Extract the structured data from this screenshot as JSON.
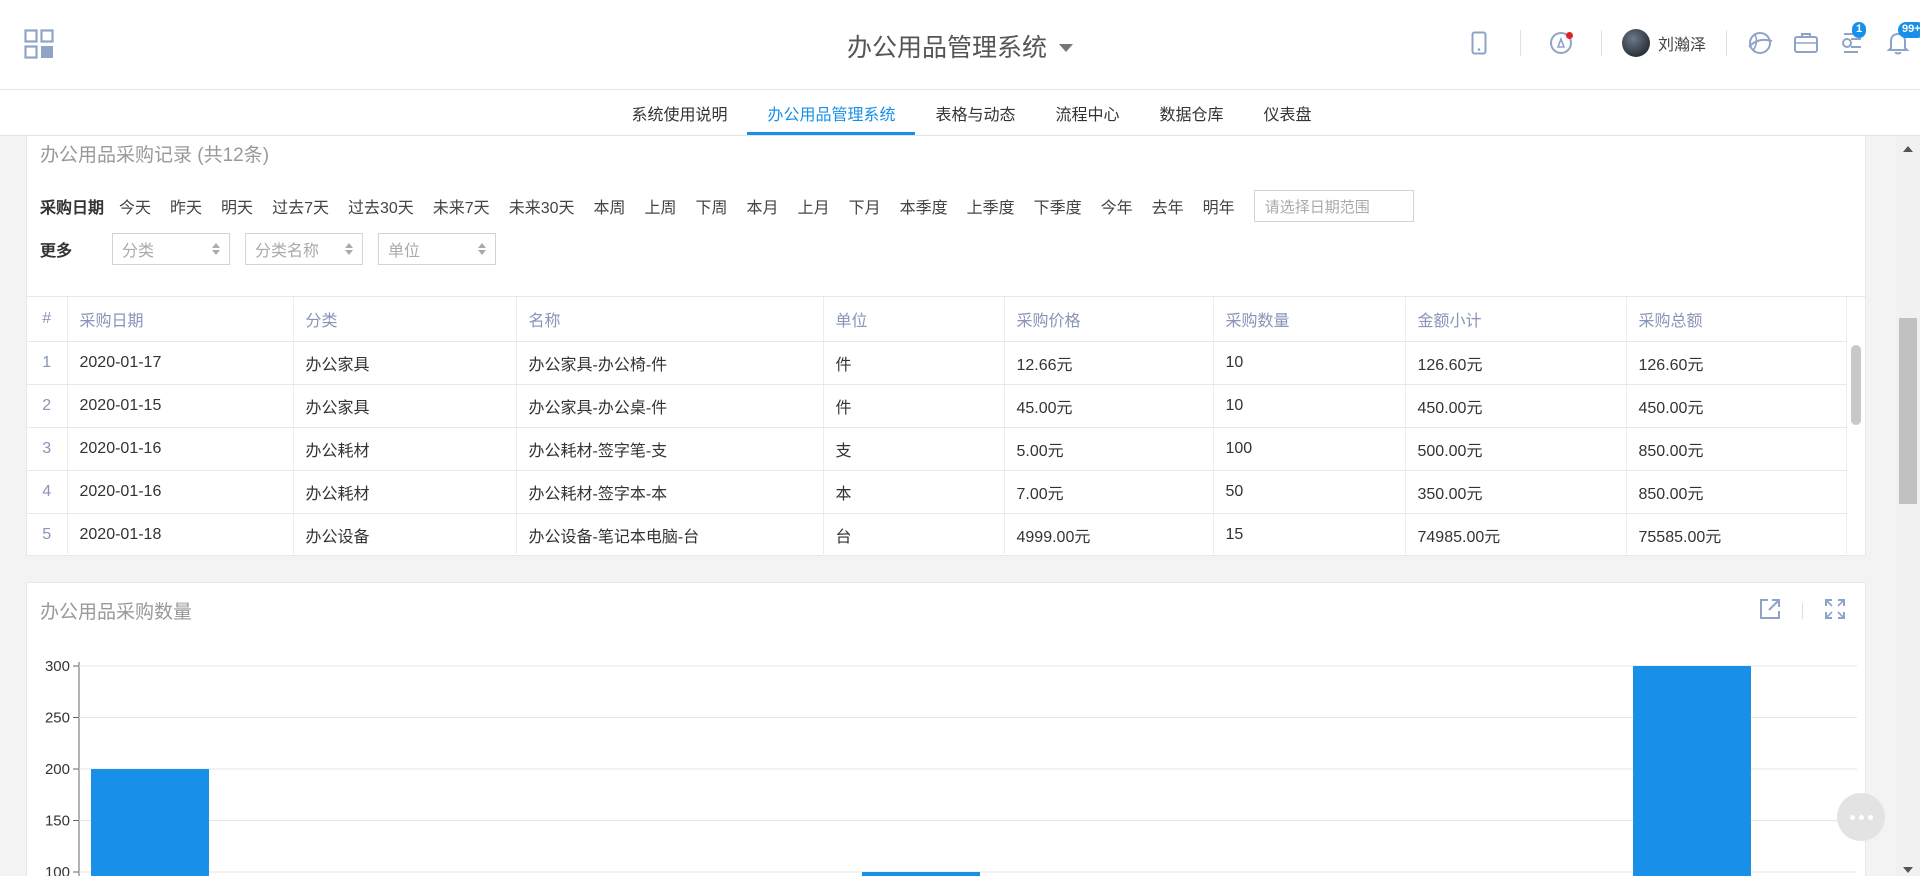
{
  "header": {
    "title": "办公用品管理系统",
    "username": "刘瀚泽",
    "tasks_badge": "1",
    "notifications_badge": "99+",
    "icons": [
      "apps-grid-icon",
      "mobile-icon",
      "compass-icon",
      "avatar",
      "earth-icon",
      "briefcase-icon",
      "tasks-icon",
      "bell-icon"
    ]
  },
  "nav": {
    "tabs": [
      {
        "label": "系统使用说明"
      },
      {
        "label": "办公用品管理系统"
      },
      {
        "label": "表格与动态"
      },
      {
        "label": "流程中心"
      },
      {
        "label": "数据仓库"
      },
      {
        "label": "仪表盘"
      }
    ],
    "active": "办公用品管理系统"
  },
  "records": {
    "title": "办公用品采购记录 (共12条)",
    "date_filter_label": "采购日期",
    "quick_ranges": [
      "今天",
      "昨天",
      "明天",
      "过去7天",
      "过去30天",
      "未来7天",
      "未来30天",
      "本周",
      "上周",
      "下周",
      "本月",
      "上月",
      "下月",
      "本季度",
      "上季度",
      "下季度",
      "今年",
      "去年",
      "明年"
    ],
    "date_range_placeholder": "请选择日期范围",
    "more_label": "更多",
    "selects": [
      "分类",
      "分类名称",
      "单位"
    ],
    "columns": [
      "#",
      "采购日期",
      "分类",
      "名称",
      "单位",
      "采购价格",
      "采购数量",
      "金额小计",
      "采购总额"
    ],
    "rows": [
      [
        "1",
        "2020-01-17",
        "办公家具",
        "办公家具-办公椅-件",
        "件",
        "12.66元",
        "10",
        "126.60元",
        "126.60元"
      ],
      [
        "2",
        "2020-01-15",
        "办公家具",
        "办公家具-办公桌-件",
        "件",
        "45.00元",
        "10",
        "450.00元",
        "450.00元"
      ],
      [
        "3",
        "2020-01-16",
        "办公耗材",
        "办公耗材-签字笔-支",
        "支",
        "5.00元",
        "100",
        "500.00元",
        "850.00元"
      ],
      [
        "4",
        "2020-01-16",
        "办公耗材",
        "办公耗材-签字本-本",
        "本",
        "7.00元",
        "50",
        "350.00元",
        "850.00元"
      ],
      [
        "5",
        "2020-01-18",
        "办公设备",
        "办公设备-笔记本电脑-台",
        "台",
        "4999.00元",
        "15",
        "74985.00元",
        "75585.00元"
      ]
    ]
  },
  "quantity_panel": {
    "title": "办公用品采购数量"
  },
  "chart_data": {
    "type": "bar",
    "yticks": [
      "300",
      "250",
      "200",
      "150",
      "100"
    ],
    "ylim": [
      100,
      300
    ],
    "grid": true,
    "bars": [
      {
        "value": 200
      },
      {
        "value": 100
      },
      {
        "value": 300
      }
    ],
    "color": "#1890e8"
  },
  "colors": {
    "accent": "#1890e8",
    "header_text": "#555555"
  }
}
